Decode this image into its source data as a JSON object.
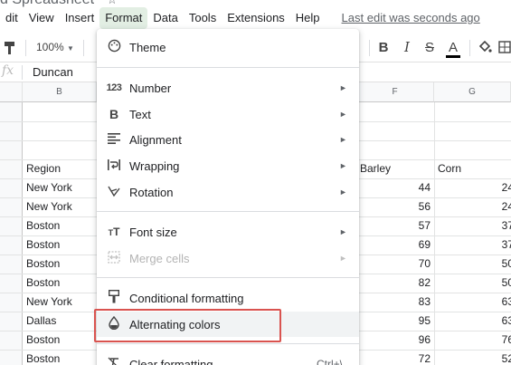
{
  "title_bar": {
    "doc_name": "d Spreadsheet",
    "star": "☆"
  },
  "menu": {
    "items": [
      "dit",
      "View",
      "Insert",
      "Format",
      "Data",
      "Tools",
      "Extensions",
      "Help"
    ],
    "active": "Format",
    "last_edit": "Last edit was seconds ago"
  },
  "toolbar": {
    "zoom": "100%",
    "bold": "B",
    "italic": "I",
    "strike": "S",
    "text_color": "A"
  },
  "formula_bar": {
    "fx": "fx",
    "content": "Duncan"
  },
  "columns": {
    "b": "B",
    "f": "F",
    "g": "G"
  },
  "cells": {
    "b_header": "Region",
    "f_header": "Barley",
    "g_header": "Corn",
    "regions": [
      "New York",
      "New York",
      "Boston",
      "Boston",
      "Boston",
      "Boston",
      "New York",
      "Dallas",
      "Boston",
      "Boston"
    ],
    "barley": [
      "44",
      "56",
      "57",
      "69",
      "70",
      "82",
      "83",
      "95",
      "96",
      "72"
    ],
    "corn": [
      "24",
      "24",
      "37",
      "37",
      "50",
      "50",
      "63",
      "63",
      "76",
      "52"
    ]
  },
  "format_menu": {
    "theme": "Theme",
    "number": "Number",
    "text": "Text",
    "alignment": "Alignment",
    "wrapping": "Wrapping",
    "rotation": "Rotation",
    "font_size": "Font size",
    "merge_cells": "Merge cells",
    "conditional_formatting": "Conditional formatting",
    "alternating_colors": "Alternating colors",
    "clear_formatting": "Clear formatting",
    "clear_shortcut": "Ctrl+\\",
    "number_icon": "123",
    "text_icon": "B"
  },
  "colors": {
    "highlight": "#d9534f",
    "menu_active_bg": "#e2eee3",
    "hover_bg": "#f1f3f4"
  }
}
